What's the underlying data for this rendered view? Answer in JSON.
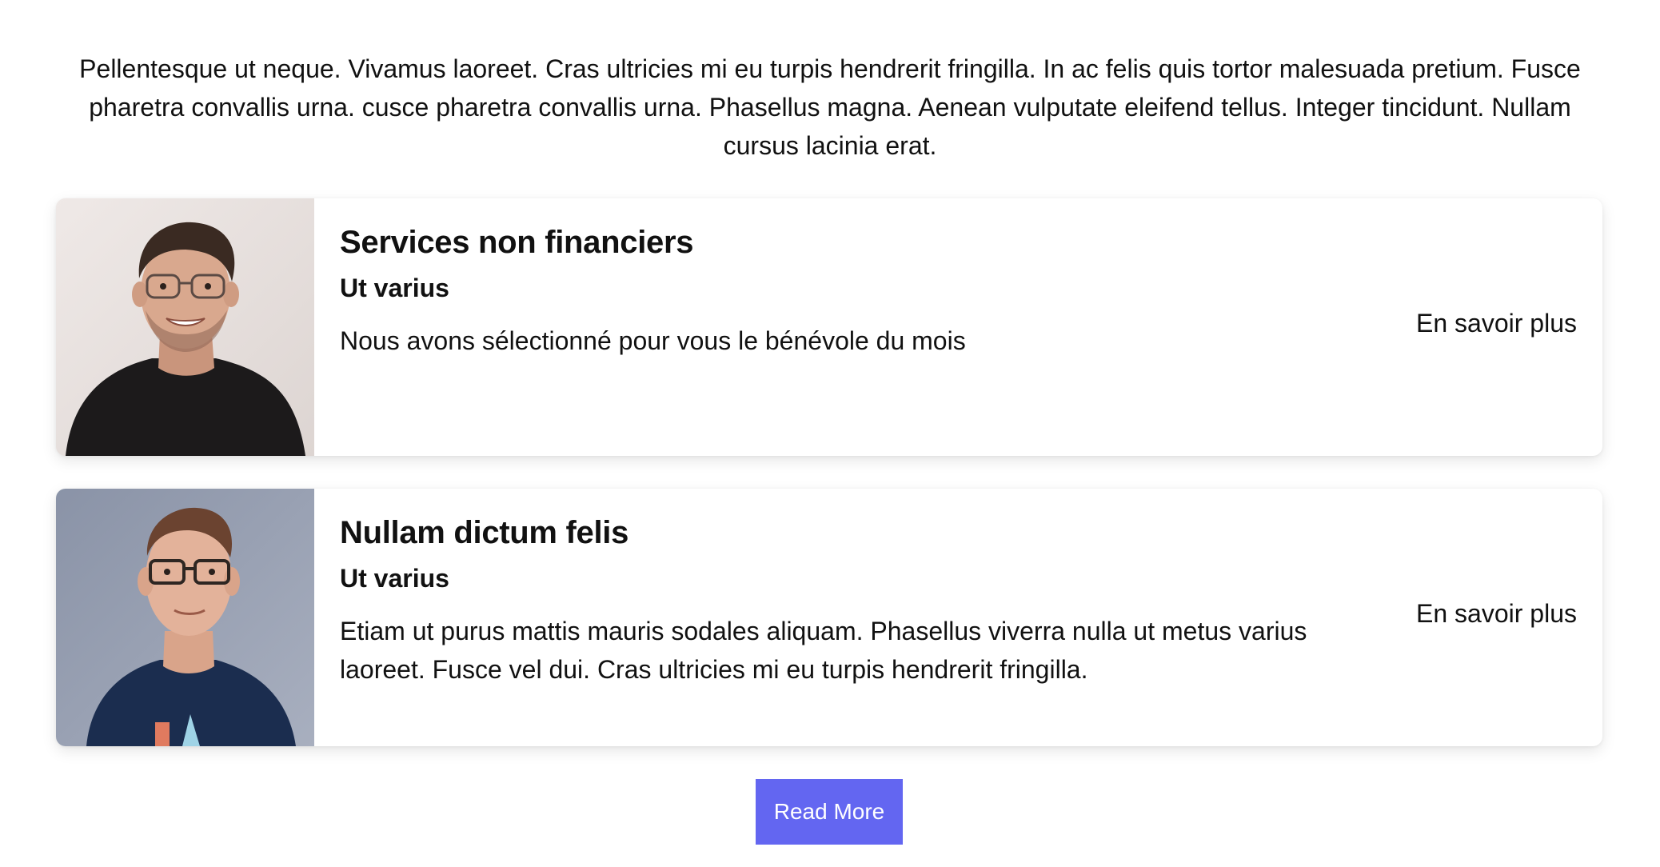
{
  "intro": {
    "text": "Pellentesque ut neque. Vivamus laoreet. Cras ultricies mi eu turpis hendrerit fringilla. In ac felis quis tortor malesuada pretium. Fusce pharetra convallis urna. cusce pharetra convallis urna. Phasellus magna. Aenean vulputate eleifend tellus. Integer tincidunt. Nullam cursus lacinia erat."
  },
  "cards": [
    {
      "title": "Services non financiers",
      "subtitle": "Ut varius",
      "text": "Nous avons sélectionné pour vous le bénévole du mois",
      "link_label": "En savoir plus"
    },
    {
      "title": "Nullam dictum felis",
      "subtitle": "Ut varius",
      "text": "Etiam ut purus mattis mauris sodales aliquam. Phasellus viverra nulla ut metus varius laoreet. Fusce vel dui. Cras ultricies mi eu turpis hendrerit fringilla.",
      "link_label": "En savoir plus"
    }
  ],
  "read_more_label": "Read More",
  "colors": {
    "accent": "#6366f1",
    "text": "#111111",
    "card_background": "#ffffff"
  }
}
